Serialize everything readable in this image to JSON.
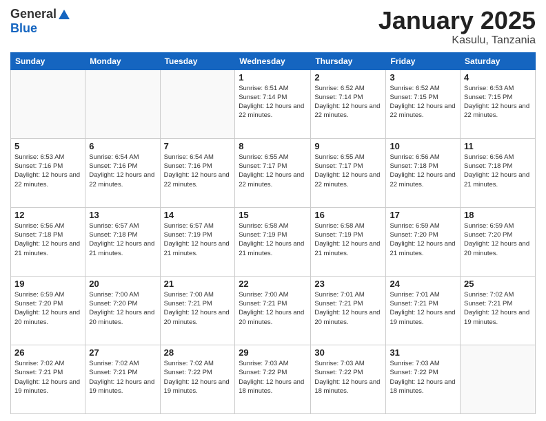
{
  "header": {
    "logo_general": "General",
    "logo_blue": "Blue",
    "month_title": "January 2025",
    "location": "Kasulu, Tanzania"
  },
  "weekdays": [
    "Sunday",
    "Monday",
    "Tuesday",
    "Wednesday",
    "Thursday",
    "Friday",
    "Saturday"
  ],
  "weeks": [
    [
      {
        "day": "",
        "sunrise": "",
        "sunset": "",
        "daylight": "",
        "empty": true
      },
      {
        "day": "",
        "sunrise": "",
        "sunset": "",
        "daylight": "",
        "empty": true
      },
      {
        "day": "",
        "sunrise": "",
        "sunset": "",
        "daylight": "",
        "empty": true
      },
      {
        "day": "1",
        "sunrise": "Sunrise: 6:51 AM",
        "sunset": "Sunset: 7:14 PM",
        "daylight": "Daylight: 12 hours and 22 minutes.",
        "empty": false
      },
      {
        "day": "2",
        "sunrise": "Sunrise: 6:52 AM",
        "sunset": "Sunset: 7:14 PM",
        "daylight": "Daylight: 12 hours and 22 minutes.",
        "empty": false
      },
      {
        "day": "3",
        "sunrise": "Sunrise: 6:52 AM",
        "sunset": "Sunset: 7:15 PM",
        "daylight": "Daylight: 12 hours and 22 minutes.",
        "empty": false
      },
      {
        "day": "4",
        "sunrise": "Sunrise: 6:53 AM",
        "sunset": "Sunset: 7:15 PM",
        "daylight": "Daylight: 12 hours and 22 minutes.",
        "empty": false
      }
    ],
    [
      {
        "day": "5",
        "sunrise": "Sunrise: 6:53 AM",
        "sunset": "Sunset: 7:16 PM",
        "daylight": "Daylight: 12 hours and 22 minutes.",
        "empty": false
      },
      {
        "day": "6",
        "sunrise": "Sunrise: 6:54 AM",
        "sunset": "Sunset: 7:16 PM",
        "daylight": "Daylight: 12 hours and 22 minutes.",
        "empty": false
      },
      {
        "day": "7",
        "sunrise": "Sunrise: 6:54 AM",
        "sunset": "Sunset: 7:16 PM",
        "daylight": "Daylight: 12 hours and 22 minutes.",
        "empty": false
      },
      {
        "day": "8",
        "sunrise": "Sunrise: 6:55 AM",
        "sunset": "Sunset: 7:17 PM",
        "daylight": "Daylight: 12 hours and 22 minutes.",
        "empty": false
      },
      {
        "day": "9",
        "sunrise": "Sunrise: 6:55 AM",
        "sunset": "Sunset: 7:17 PM",
        "daylight": "Daylight: 12 hours and 22 minutes.",
        "empty": false
      },
      {
        "day": "10",
        "sunrise": "Sunrise: 6:56 AM",
        "sunset": "Sunset: 7:18 PM",
        "daylight": "Daylight: 12 hours and 22 minutes.",
        "empty": false
      },
      {
        "day": "11",
        "sunrise": "Sunrise: 6:56 AM",
        "sunset": "Sunset: 7:18 PM",
        "daylight": "Daylight: 12 hours and 21 minutes.",
        "empty": false
      }
    ],
    [
      {
        "day": "12",
        "sunrise": "Sunrise: 6:56 AM",
        "sunset": "Sunset: 7:18 PM",
        "daylight": "Daylight: 12 hours and 21 minutes.",
        "empty": false
      },
      {
        "day": "13",
        "sunrise": "Sunrise: 6:57 AM",
        "sunset": "Sunset: 7:18 PM",
        "daylight": "Daylight: 12 hours and 21 minutes.",
        "empty": false
      },
      {
        "day": "14",
        "sunrise": "Sunrise: 6:57 AM",
        "sunset": "Sunset: 7:19 PM",
        "daylight": "Daylight: 12 hours and 21 minutes.",
        "empty": false
      },
      {
        "day": "15",
        "sunrise": "Sunrise: 6:58 AM",
        "sunset": "Sunset: 7:19 PM",
        "daylight": "Daylight: 12 hours and 21 minutes.",
        "empty": false
      },
      {
        "day": "16",
        "sunrise": "Sunrise: 6:58 AM",
        "sunset": "Sunset: 7:19 PM",
        "daylight": "Daylight: 12 hours and 21 minutes.",
        "empty": false
      },
      {
        "day": "17",
        "sunrise": "Sunrise: 6:59 AM",
        "sunset": "Sunset: 7:20 PM",
        "daylight": "Daylight: 12 hours and 21 minutes.",
        "empty": false
      },
      {
        "day": "18",
        "sunrise": "Sunrise: 6:59 AM",
        "sunset": "Sunset: 7:20 PM",
        "daylight": "Daylight: 12 hours and 20 minutes.",
        "empty": false
      }
    ],
    [
      {
        "day": "19",
        "sunrise": "Sunrise: 6:59 AM",
        "sunset": "Sunset: 7:20 PM",
        "daylight": "Daylight: 12 hours and 20 minutes.",
        "empty": false
      },
      {
        "day": "20",
        "sunrise": "Sunrise: 7:00 AM",
        "sunset": "Sunset: 7:20 PM",
        "daylight": "Daylight: 12 hours and 20 minutes.",
        "empty": false
      },
      {
        "day": "21",
        "sunrise": "Sunrise: 7:00 AM",
        "sunset": "Sunset: 7:21 PM",
        "daylight": "Daylight: 12 hours and 20 minutes.",
        "empty": false
      },
      {
        "day": "22",
        "sunrise": "Sunrise: 7:00 AM",
        "sunset": "Sunset: 7:21 PM",
        "daylight": "Daylight: 12 hours and 20 minutes.",
        "empty": false
      },
      {
        "day": "23",
        "sunrise": "Sunrise: 7:01 AM",
        "sunset": "Sunset: 7:21 PM",
        "daylight": "Daylight: 12 hours and 20 minutes.",
        "empty": false
      },
      {
        "day": "24",
        "sunrise": "Sunrise: 7:01 AM",
        "sunset": "Sunset: 7:21 PM",
        "daylight": "Daylight: 12 hours and 19 minutes.",
        "empty": false
      },
      {
        "day": "25",
        "sunrise": "Sunrise: 7:02 AM",
        "sunset": "Sunset: 7:21 PM",
        "daylight": "Daylight: 12 hours and 19 minutes.",
        "empty": false
      }
    ],
    [
      {
        "day": "26",
        "sunrise": "Sunrise: 7:02 AM",
        "sunset": "Sunset: 7:21 PM",
        "daylight": "Daylight: 12 hours and 19 minutes.",
        "empty": false
      },
      {
        "day": "27",
        "sunrise": "Sunrise: 7:02 AM",
        "sunset": "Sunset: 7:21 PM",
        "daylight": "Daylight: 12 hours and 19 minutes.",
        "empty": false
      },
      {
        "day": "28",
        "sunrise": "Sunrise: 7:02 AM",
        "sunset": "Sunset: 7:22 PM",
        "daylight": "Daylight: 12 hours and 19 minutes.",
        "empty": false
      },
      {
        "day": "29",
        "sunrise": "Sunrise: 7:03 AM",
        "sunset": "Sunset: 7:22 PM",
        "daylight": "Daylight: 12 hours and 18 minutes.",
        "empty": false
      },
      {
        "day": "30",
        "sunrise": "Sunrise: 7:03 AM",
        "sunset": "Sunset: 7:22 PM",
        "daylight": "Daylight: 12 hours and 18 minutes.",
        "empty": false
      },
      {
        "day": "31",
        "sunrise": "Sunrise: 7:03 AM",
        "sunset": "Sunset: 7:22 PM",
        "daylight": "Daylight: 12 hours and 18 minutes.",
        "empty": false
      },
      {
        "day": "",
        "sunrise": "",
        "sunset": "",
        "daylight": "",
        "empty": true
      }
    ]
  ]
}
